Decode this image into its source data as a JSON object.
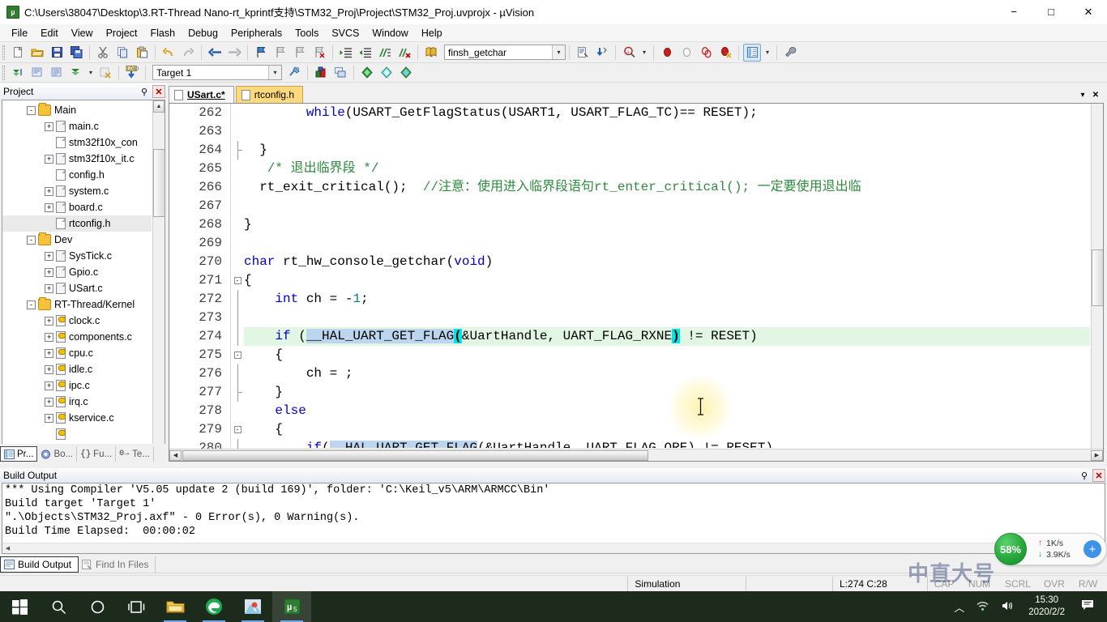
{
  "window": {
    "title": "C:\\Users\\38047\\Desktop\\3.RT-Thread Nano-rt_kprintf支持\\STM32_Proj\\Project\\STM32_Proj.uvprojx - µVision",
    "app_icon": "uvision-icon",
    "minimize": "−",
    "maximize": "□",
    "close": "✕"
  },
  "menu": {
    "items": [
      "File",
      "Edit",
      "View",
      "Project",
      "Flash",
      "Debug",
      "Peripherals",
      "Tools",
      "SVCS",
      "Window",
      "Help"
    ]
  },
  "toolbar": {
    "finsh_combo_value": "finsh_getchar",
    "target_combo_value": "Target 1",
    "buttons_row1": [
      "new-file-icon",
      "open-file-icon",
      "save-icon",
      "save-all-icon",
      "cut-icon",
      "copy-icon",
      "paste-icon",
      "undo-icon",
      "redo-icon",
      "navigate-back-icon",
      "navigate-forward-icon",
      "bookmark-toggle-icon",
      "bookmark-prev-icon",
      "bookmark-next-icon",
      "bookmark-clear-icon",
      "indent-icon",
      "outdent-icon",
      "comment-icon",
      "uncomment-icon",
      "goto-definition-icon"
    ],
    "buttons_row2": [
      "build-icon",
      "rebuild-icon",
      "batch-build-icon",
      "translate-icon",
      "stop-build-icon",
      "download-icon"
    ],
    "buttons_row2_right": [
      "target-options-icon",
      "manage-components-icon",
      "books-icon",
      "functions-icon",
      "templates-icon",
      "source-browser-icon"
    ],
    "buttons_row1_right": [
      "debug-icon",
      "insert-bookmark-icon",
      "find-icon",
      "breakpoint-icon",
      "breakpoint-disable-icon",
      "breakpoints-all-icon",
      "breakpoints-kill-icon",
      "window-layout-icon",
      "configure-icon"
    ]
  },
  "project_panel": {
    "title": "Project",
    "pin_icon": "pin-icon",
    "close_icon": "close-icon",
    "tree": [
      {
        "label": "Main",
        "type": "folder",
        "depth": 1,
        "expander": "-",
        "selected": false
      },
      {
        "label": "main.c",
        "type": "file-c",
        "depth": 2,
        "expander": "+",
        "selected": false
      },
      {
        "label": "stm32f10x_con",
        "type": "file-h",
        "depth": 2,
        "expander": "",
        "selected": false
      },
      {
        "label": "stm32f10x_it.c",
        "type": "file-c",
        "depth": 2,
        "expander": "+",
        "selected": false
      },
      {
        "label": "config.h",
        "type": "file-h",
        "depth": 2,
        "expander": "",
        "selected": false
      },
      {
        "label": "system.c",
        "type": "file-c",
        "depth": 2,
        "expander": "+",
        "selected": false
      },
      {
        "label": "board.c",
        "type": "file-c",
        "depth": 2,
        "expander": "+",
        "selected": false
      },
      {
        "label": "rtconfig.h",
        "type": "file-h",
        "depth": 2,
        "expander": "",
        "selected": true
      },
      {
        "label": "Dev",
        "type": "folder",
        "depth": 1,
        "expander": "-",
        "selected": false
      },
      {
        "label": "SysTick.c",
        "type": "file-c",
        "depth": 2,
        "expander": "+",
        "selected": false
      },
      {
        "label": "Gpio.c",
        "type": "file-c",
        "depth": 2,
        "expander": "+",
        "selected": false
      },
      {
        "label": "USart.c",
        "type": "file-c",
        "depth": 2,
        "expander": "+",
        "selected": false
      },
      {
        "label": "RT-Thread/Kernel",
        "type": "folder",
        "depth": 1,
        "expander": "-",
        "selected": false
      },
      {
        "label": "clock.c",
        "type": "file-key",
        "depth": 2,
        "expander": "+",
        "selected": false
      },
      {
        "label": "components.c",
        "type": "file-key",
        "depth": 2,
        "expander": "+",
        "selected": false
      },
      {
        "label": "cpu.c",
        "type": "file-key",
        "depth": 2,
        "expander": "+",
        "selected": false
      },
      {
        "label": "idle.c",
        "type": "file-key",
        "depth": 2,
        "expander": "+",
        "selected": false
      },
      {
        "label": "ipc.c",
        "type": "file-key",
        "depth": 2,
        "expander": "+",
        "selected": false
      },
      {
        "label": "irq.c",
        "type": "file-key",
        "depth": 2,
        "expander": "+",
        "selected": false
      },
      {
        "label": "kservice.c",
        "type": "file-key",
        "depth": 2,
        "expander": "+",
        "selected": false
      },
      {
        "label": "",
        "type": "file-key",
        "depth": 2,
        "expander": "",
        "selected": false
      }
    ],
    "tabs": [
      {
        "label": "Pr...",
        "icon": "project-icon",
        "active": true
      },
      {
        "label": "Bo...",
        "icon": "books-icon",
        "active": false
      },
      {
        "label": "Fu...",
        "icon": "functions-icon",
        "active": false
      },
      {
        "label": "Te...",
        "icon": "templates-icon",
        "active": false
      }
    ]
  },
  "editor": {
    "tabs": [
      {
        "label": "USart.c*",
        "active": true,
        "style": "active"
      },
      {
        "label": "rtconfig.h",
        "active": false,
        "style": "modified-alt"
      }
    ],
    "tab_buttons": [
      "chevron-down-icon",
      "close-icon"
    ],
    "first_line_number": 262,
    "lines": [
      {
        "n": 262,
        "fold": "",
        "hl": false,
        "segments": [
          {
            "t": "        ",
            "c": ""
          },
          {
            "t": "while",
            "c": "kw"
          },
          {
            "t": "(USART_GetFlagStatus(USART1, USART_FLAG_TC)== RESET);",
            "c": ""
          }
        ]
      },
      {
        "n": 263,
        "fold": "",
        "hl": false,
        "segments": []
      },
      {
        "n": 264,
        "fold": "tick",
        "hl": false,
        "segments": [
          {
            "t": "  }",
            "c": ""
          }
        ]
      },
      {
        "n": 265,
        "fold": "",
        "hl": false,
        "segments": [
          {
            "t": "   /* 退出临界段 */",
            "c": "cm"
          }
        ]
      },
      {
        "n": 266,
        "fold": "",
        "hl": false,
        "segments": [
          {
            "t": "  rt_exit_critical();  ",
            "c": ""
          },
          {
            "t": "//注意：使用进入临界段语句rt_enter_critical(); 一定要使用退出临",
            "c": "cm"
          }
        ]
      },
      {
        "n": 267,
        "fold": "",
        "hl": false,
        "segments": []
      },
      {
        "n": 268,
        "fold": "",
        "hl": false,
        "segments": [
          {
            "t": "}",
            "c": ""
          }
        ]
      },
      {
        "n": 269,
        "fold": "",
        "hl": false,
        "segments": []
      },
      {
        "n": 270,
        "fold": "",
        "hl": false,
        "segments": [
          {
            "t": "char",
            "c": "kw"
          },
          {
            "t": " rt_hw_console_getchar(",
            "c": ""
          },
          {
            "t": "void",
            "c": "kw"
          },
          {
            "t": ")",
            "c": ""
          }
        ]
      },
      {
        "n": 271,
        "fold": "box",
        "hl": false,
        "segments": [
          {
            "t": "{",
            "c": ""
          }
        ]
      },
      {
        "n": 272,
        "fold": "line",
        "hl": false,
        "segments": [
          {
            "t": "    ",
            "c": ""
          },
          {
            "t": "int",
            "c": "kw"
          },
          {
            "t": " ch = -",
            "c": ""
          },
          {
            "t": "1",
            "c": "num"
          },
          {
            "t": ";",
            "c": ""
          }
        ]
      },
      {
        "n": 273,
        "fold": "line",
        "hl": false,
        "segments": []
      },
      {
        "n": 274,
        "fold": "line",
        "hl": true,
        "segments": [
          {
            "t": "    ",
            "c": ""
          },
          {
            "t": "if",
            "c": "kw"
          },
          {
            "t": " (",
            "c": ""
          },
          {
            "t": "__HAL_UART_GET_FLAG",
            "c": "sel"
          },
          {
            "t": "(",
            "c": "bracket"
          },
          {
            "t": "&UartHandle, UART_FLAG_RXNE",
            "c": ""
          },
          {
            "t": ")",
            "c": "bracket"
          },
          {
            "t": " != RESET)",
            "c": ""
          }
        ]
      },
      {
        "n": 275,
        "fold": "box",
        "hl": false,
        "segments": [
          {
            "t": "    {",
            "c": ""
          }
        ]
      },
      {
        "n": 276,
        "fold": "line",
        "hl": false,
        "segments": [
          {
            "t": "        ch = ;",
            "c": ""
          }
        ]
      },
      {
        "n": 277,
        "fold": "tick",
        "hl": false,
        "segments": [
          {
            "t": "    }",
            "c": ""
          }
        ]
      },
      {
        "n": 278,
        "fold": "",
        "hl": false,
        "segments": [
          {
            "t": "    ",
            "c": ""
          },
          {
            "t": "else",
            "c": "kw"
          }
        ]
      },
      {
        "n": 279,
        "fold": "box",
        "hl": false,
        "segments": [
          {
            "t": "    {",
            "c": ""
          }
        ]
      },
      {
        "n": 280,
        "fold": "line",
        "hl": false,
        "segments": [
          {
            "t": "        ",
            "c": ""
          },
          {
            "t": "if",
            "c": "kw"
          },
          {
            "t": "(",
            "c": ""
          },
          {
            "t": "__HAL_UART_GET_FLAG",
            "c": "sel"
          },
          {
            "t": "(&UartHandle, UART_FLAG_ORE) != RESET)",
            "c": ""
          }
        ]
      }
    ]
  },
  "build_output": {
    "title": "Build Output",
    "pin_icon": "pin-icon",
    "close_icon": "close-icon",
    "lines": [
      "*** Using Compiler 'V5.05 update 2 (build 169)', folder: 'C:\\Keil_v5\\ARM\\ARMCC\\Bin'",
      "Build target 'Target 1'",
      "\".\\Objects\\STM32_Proj.axf\" - 0 Error(s), 0 Warning(s).",
      "Build Time Elapsed:  00:00:02"
    ]
  },
  "output_tabs": [
    {
      "label": "Build Output",
      "icon": "build-output-icon",
      "active": true
    },
    {
      "label": "Find In Files",
      "icon": "find-in-files-icon",
      "active": false
    }
  ],
  "statusbar": {
    "simulation": "Simulation",
    "cursor_position": "L:274 C:28",
    "indicators": [
      "CAP",
      "NUM",
      "SCRL",
      "OVR",
      "R/W"
    ]
  },
  "net_widget": {
    "percent": "58%",
    "upload_rate": "1K/s",
    "download_rate": "3.9K/s",
    "upload_arrow": "↑",
    "download_arrow": "↓",
    "add_label": "+"
  },
  "watermark": {
    "text": "中直大号"
  },
  "taskbar": {
    "items": [
      {
        "name": "start-button",
        "icon": "windows-icon"
      },
      {
        "name": "search-button",
        "icon": "search-icon"
      },
      {
        "name": "cortana-button",
        "icon": "circle-icon"
      },
      {
        "name": "task-view-button",
        "icon": "task-view-icon"
      },
      {
        "name": "file-explorer-button",
        "icon": "folder-icon"
      },
      {
        "name": "browser-button",
        "icon": "edge-icon"
      },
      {
        "name": "photos-button",
        "icon": "photos-icon"
      },
      {
        "name": "uvision-button",
        "icon": "uvision-icon"
      }
    ],
    "tray": {
      "chevron": "︿",
      "network_icon": "wifi-icon",
      "volume_icon": "speaker-icon",
      "time": "15:30",
      "date": "2020/2/2",
      "notification_icon": "notification-icon"
    }
  },
  "colors": {
    "keyword": "#0000c8",
    "comment": "#2e8b3d",
    "number": "#008080",
    "selection": "#bdd6f0",
    "bracket_match": "#00e5e5",
    "line_highlight": "#e2f6e4",
    "taskbar": "#1c2b1c",
    "accent_green": "#27a83c"
  }
}
